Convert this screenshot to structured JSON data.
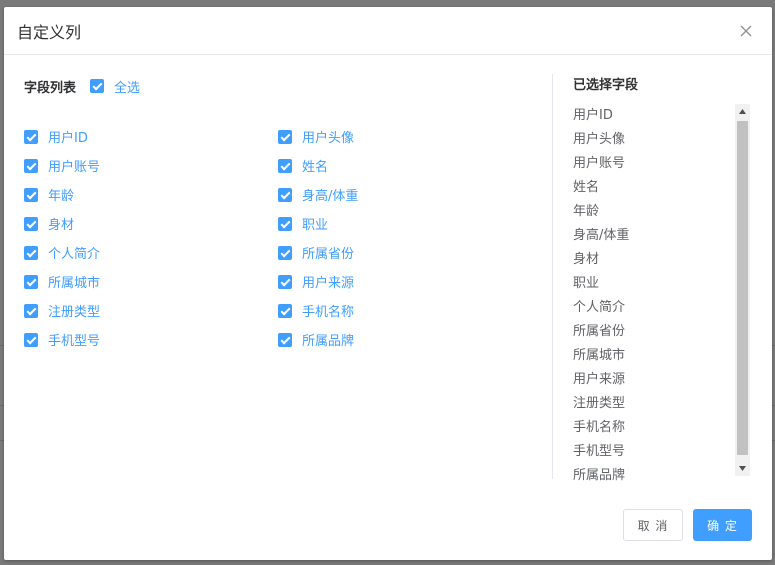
{
  "dialog": {
    "title": "自定义列",
    "close_icon": "close-icon"
  },
  "fields_panel": {
    "title": "字段列表",
    "select_all_label": "全选",
    "select_all_checked": true,
    "left_column": [
      {
        "label": "用户ID",
        "checked": true
      },
      {
        "label": "用户账号",
        "checked": true
      },
      {
        "label": "年龄",
        "checked": true
      },
      {
        "label": "身材",
        "checked": true
      },
      {
        "label": "个人简介",
        "checked": true
      },
      {
        "label": "所属城市",
        "checked": true
      },
      {
        "label": "注册类型",
        "checked": true
      },
      {
        "label": "手机型号",
        "checked": true
      }
    ],
    "right_column": [
      {
        "label": "用户头像",
        "checked": true
      },
      {
        "label": "姓名",
        "checked": true
      },
      {
        "label": "身高/体重",
        "checked": true
      },
      {
        "label": "职业",
        "checked": true
      },
      {
        "label": "所属省份",
        "checked": true
      },
      {
        "label": "用户来源",
        "checked": true
      },
      {
        "label": "手机名称",
        "checked": true
      },
      {
        "label": "所属品牌",
        "checked": true
      }
    ]
  },
  "selected_panel": {
    "title": "已选择字段",
    "items": [
      "用户ID",
      "用户头像",
      "用户账号",
      "姓名",
      "年龄",
      "身高/体重",
      "身材",
      "职业",
      "个人简介",
      "所属省份",
      "所属城市",
      "用户来源",
      "注册类型",
      "手机名称",
      "手机型号",
      "所属品牌"
    ]
  },
  "footer": {
    "cancel_label": "取 消",
    "ok_label": "确 定"
  },
  "colors": {
    "primary": "#409eff",
    "overlay": "#7a7a7a"
  }
}
